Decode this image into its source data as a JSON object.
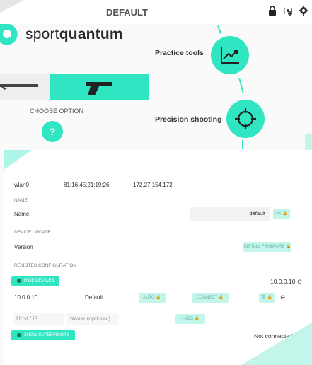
{
  "header": {
    "title": "DEFAULT",
    "icons": [
      "lock-icon",
      "wifi-icon",
      "settings-icon"
    ]
  },
  "logo": {
    "light": "sport",
    "bold": "quantum"
  },
  "modes": {
    "practice": "Practice tools",
    "precision": "Precision shooting"
  },
  "choose": {
    "label": "CHOOSE OPTION",
    "help": "?"
  },
  "network": {
    "iface": "wlan0",
    "mac": "81:16:45:21:19:26",
    "ip": "172.27.154.172"
  },
  "name_section": {
    "heading": "NAME",
    "label": "Name",
    "value": "default",
    "ok": "OK"
  },
  "update_section": {
    "heading": "DEVICE UPDATE",
    "label": "Version",
    "install": "INSTALL FIRMWARE"
  },
  "remotes": {
    "heading": "REMOTES CONFIGURATION",
    "hide_devices": "HIDE DEVICES",
    "address_right": "10.0.0.10",
    "device": {
      "ip": "10.0.0.10",
      "name": "Default",
      "auto": "AUTO",
      "connect": "CONNECT"
    },
    "host_placeholder": "Host / IP",
    "name_placeholder": "Name (optional)",
    "add": "+ ADD",
    "show_supervisors": "SHOW SUPERVISORS",
    "status": "Not connected"
  },
  "colors": {
    "accent": "#30e6c2",
    "accent_light": "#c3f5ea",
    "error": "#e53935"
  }
}
